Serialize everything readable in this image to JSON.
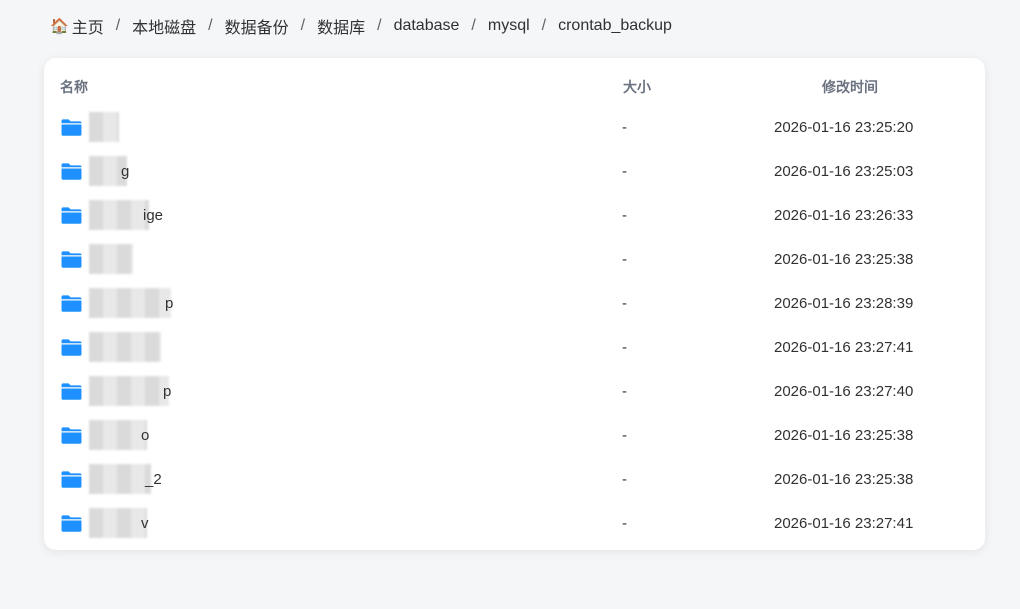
{
  "breadcrumb": [
    {
      "label": "主页",
      "icon": "home-icon"
    },
    {
      "label": "本地磁盘"
    },
    {
      "label": "数据备份"
    },
    {
      "label": "数据库"
    },
    {
      "label": "database"
    },
    {
      "label": "mysql"
    },
    {
      "label": "crontab_backup"
    }
  ],
  "breadcrumb_separator": "/",
  "table": {
    "headers": {
      "name": "名称",
      "size": "大小",
      "modified": "修改时间"
    },
    "rows": [
      {
        "name": "",
        "size": "-",
        "modified": "2026-01-16 23:25:20"
      },
      {
        "name": "g",
        "size": "-",
        "modified": "2026-01-16 23:25:03"
      },
      {
        "name": "ige",
        "size": "-",
        "modified": "2026-01-16 23:26:33"
      },
      {
        "name": "",
        "size": "-",
        "modified": "2026-01-16 23:25:38"
      },
      {
        "name": "p",
        "size": "-",
        "modified": "2026-01-16 23:28:39"
      },
      {
        "name": "",
        "size": "-",
        "modified": "2026-01-16 23:27:41"
      },
      {
        "name": "p",
        "size": "-",
        "modified": "2026-01-16 23:27:40"
      },
      {
        "name": "o",
        "size": "-",
        "modified": "2026-01-16 23:25:38"
      },
      {
        "name": "_2",
        "size": "-",
        "modified": "2026-01-16 23:25:38"
      },
      {
        "name": "v",
        "size": "-",
        "modified": "2026-01-16 23:27:41"
      }
    ]
  },
  "colors": {
    "folder": "#1e90ff",
    "background": "#f5f6f8",
    "header_text": "#6b7280"
  }
}
